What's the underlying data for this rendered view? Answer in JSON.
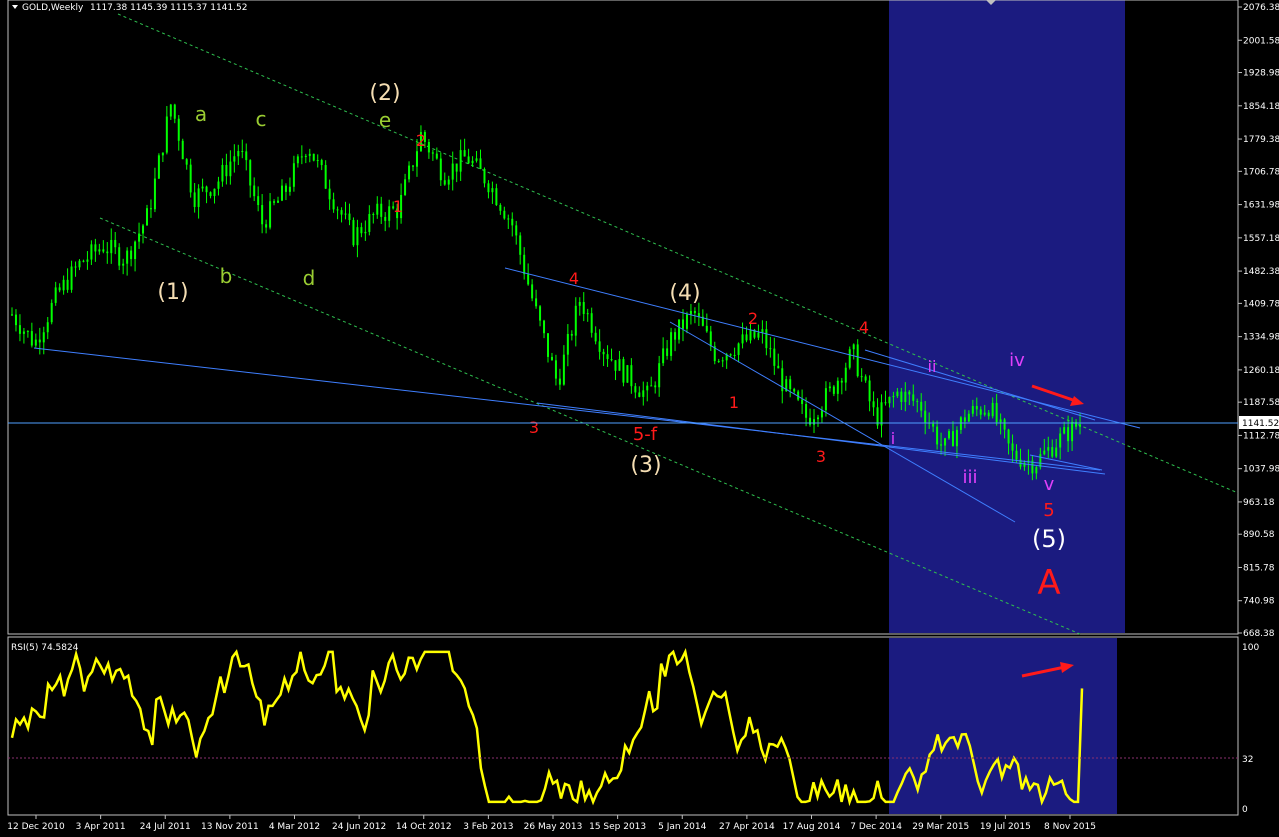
{
  "header": {
    "symbol": "GOLD,Weekly",
    "ohlc": "1117.38 1145.39 1115.37 1141.52"
  },
  "rsi_panel": {
    "label": "RSI(5) 74.5824",
    "levels": [
      "100",
      "32",
      "0"
    ]
  },
  "colors": {
    "background": "#000000",
    "candles": "#00ff00",
    "rsi_line": "#ffff00",
    "trendlines": "#3f7fff",
    "channel": "#2fbf4f",
    "highlight": "#1b1b80",
    "wave_red": "#ff1a1a",
    "wave_green": "#9acd32",
    "wave_cream": "#f5deb3",
    "wave_magenta": "#e040fb",
    "price_line": "#4f9fff"
  },
  "chart_data": {
    "type": "candlestick",
    "title": "GOLD,Weekly",
    "ylim": [
      668.38,
      2076.38
    ],
    "y_ticks": [
      "2076.38",
      "2001.58",
      "1928.98",
      "1854.18",
      "1779.38",
      "1706.78",
      "1631.98",
      "1557.18",
      "1482.38",
      "1409.78",
      "1334.98",
      "1260.18",
      "1187.58",
      "1112.78",
      "1037.98",
      "963.18",
      "890.58",
      "815.78",
      "740.98",
      "668.38"
    ],
    "current_price": "1141.52",
    "x_ticks": [
      "12 Dec 2010",
      "3 Apr 2011",
      "24 Jul 2011",
      "13 Nov 2011",
      "4 Mar 2012",
      "24 Jun 2012",
      "14 Oct 2012",
      "3 Feb 2013",
      "26 May 2013",
      "15 Sep 2013",
      "5 Jan 2014",
      "27 Apr 2014",
      "17 Aug 2014",
      "7 Dec 2014",
      "29 Mar 2015",
      "19 Jul 2015",
      "8 Nov 2015"
    ],
    "price_path": [
      [
        "12 Dec 2010",
        1385
      ],
      [
        "Feb 2011",
        1320
      ],
      [
        "Mar 2011",
        1430
      ],
      [
        "Apr 2011",
        1500
      ],
      [
        "May 2011",
        1540
      ],
      [
        "Jun 2011",
        1510
      ],
      [
        "Jul 2011",
        1610
      ],
      [
        "Aug 2011",
        1860
      ],
      [
        "Sep 2011",
        1650
      ],
      [
        "Oct 2011",
        1680
      ],
      [
        "Nov 2011",
        1760
      ],
      [
        "Dec 2011",
        1590
      ],
      [
        "Jan 2012",
        1660
      ],
      [
        "Feb 2012",
        1770
      ],
      [
        "Mar 2012",
        1660
      ],
      [
        "May 2012",
        1560
      ],
      [
        "Jun 2012",
        1610
      ],
      [
        "Aug 2012",
        1620
      ],
      [
        "Oct 2012",
        1790
      ],
      [
        "Nov 2012",
        1700
      ],
      [
        "Dec 2012",
        1740
      ],
      [
        "Jan 2013",
        1680
      ],
      [
        "Feb 2013",
        1590
      ],
      [
        "Apr 2013",
        1400
      ],
      [
        "Jun 2013",
        1230
      ],
      [
        "Aug 2013",
        1420
      ],
      [
        "Sep 2013",
        1310
      ],
      [
        "Nov 2013",
        1250
      ],
      [
        "Dec 2013",
        1200
      ],
      [
        "Feb 2014",
        1330
      ],
      [
        "Mar 2014",
        1390
      ],
      [
        "Apr 2014",
        1290
      ],
      [
        "Jun 2014",
        1320
      ],
      [
        "Jul 2014",
        1340
      ],
      [
        "Sep 2014",
        1220
      ],
      [
        "Nov 2014",
        1150
      ],
      [
        "Dec 2014",
        1210
      ],
      [
        "Jan 2015",
        1300
      ],
      [
        "Mar 2015",
        1150
      ],
      [
        "May 2015",
        1210
      ],
      [
        "Jun 2015",
        1180
      ],
      [
        "Jul 2015",
        1080
      ],
      [
        "Aug 2015",
        1160
      ],
      [
        "Oct 2015",
        1180
      ],
      [
        "Nov 2015",
        1070
      ],
      [
        "Dec 2015",
        1050
      ],
      [
        "Jan 2016",
        1100
      ],
      [
        "Feb 2016",
        1141.52
      ]
    ],
    "wave_labels": [
      {
        "text": "(1)",
        "color": "cream"
      },
      {
        "text": "a",
        "color": "green"
      },
      {
        "text": "b",
        "color": "green"
      },
      {
        "text": "c",
        "color": "green"
      },
      {
        "text": "d",
        "color": "green"
      },
      {
        "text": "(2)",
        "color": "cream"
      },
      {
        "text": "e",
        "color": "green"
      },
      {
        "text": "1",
        "color": "red"
      },
      {
        "text": "2",
        "color": "red"
      },
      {
        "text": "3",
        "color": "red"
      },
      {
        "text": "4",
        "color": "red"
      },
      {
        "text": "5-f",
        "color": "red"
      },
      {
        "text": "(3)",
        "color": "cream"
      },
      {
        "text": "(4)",
        "color": "cream"
      },
      {
        "text": "2",
        "color": "red"
      },
      {
        "text": "1",
        "color": "red"
      },
      {
        "text": "3",
        "color": "red"
      },
      {
        "text": "4",
        "color": "red"
      },
      {
        "text": "i",
        "color": "magenta"
      },
      {
        "text": "ii",
        "color": "magenta"
      },
      {
        "text": "iii",
        "color": "magenta"
      },
      {
        "text": "iv",
        "color": "magenta"
      },
      {
        "text": "v",
        "color": "magenta"
      },
      {
        "text": "5",
        "color": "red"
      },
      {
        "text": "(5)",
        "color": "white"
      },
      {
        "text": "A",
        "color": "red"
      }
    ],
    "rsi": {
      "name": "RSI(5)",
      "last": 74.5824,
      "ylim": [
        0,
        100
      ],
      "levels": [
        32
      ]
    }
  }
}
